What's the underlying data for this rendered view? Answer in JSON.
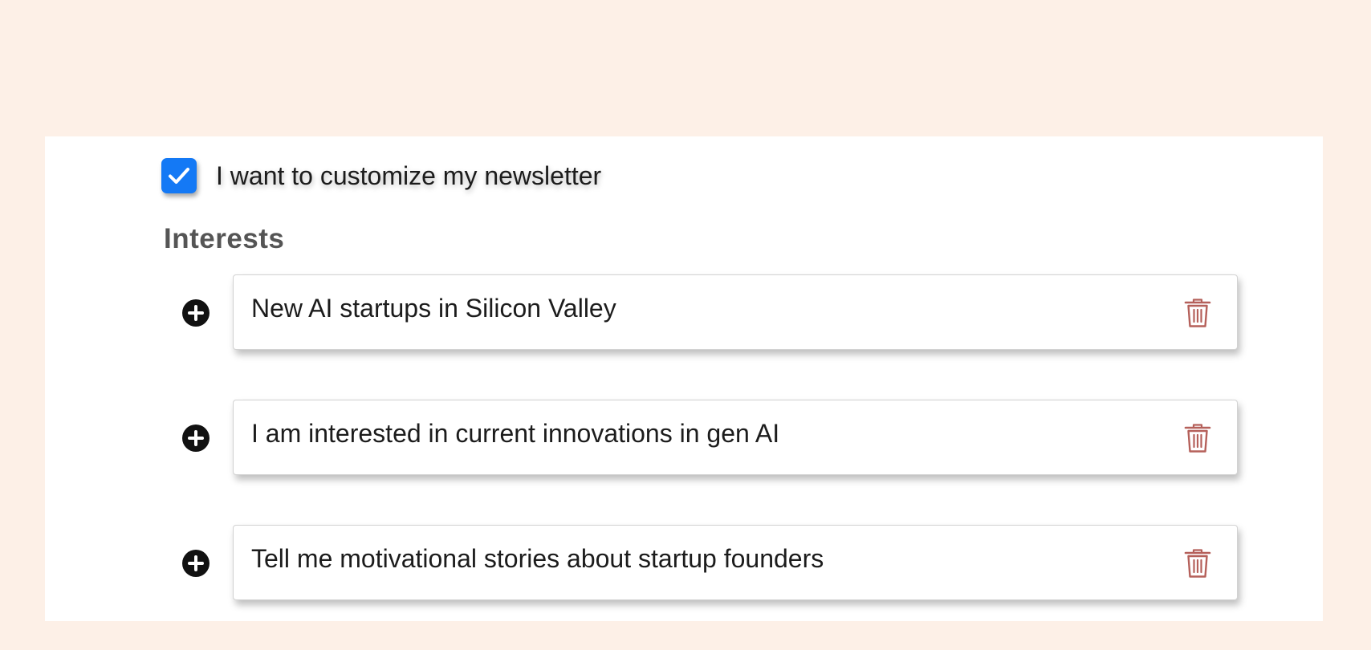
{
  "newsletter": {
    "customize_label": "I want to customize my newsletter",
    "customize_checked": true
  },
  "interests": {
    "title": "Interests",
    "items": [
      {
        "value": "New AI startups in Silicon Valley",
        "add_icon": "plus-circle-icon",
        "delete_icon": "trash-icon"
      },
      {
        "value": "I am interested in current innovations in gen AI",
        "add_icon": "plus-circle-icon",
        "delete_icon": "trash-icon"
      },
      {
        "value": "Tell me motivational stories about startup founders",
        "add_icon": "plus-circle-icon",
        "delete_icon": "trash-icon"
      }
    ]
  },
  "colors": {
    "page_background": "#fdf0e7",
    "panel_background": "#ffffff",
    "checkbox_accent": "#1479f5",
    "section_title": "#555555",
    "trash_icon": "#b5605a",
    "add_icon": "#111111"
  }
}
